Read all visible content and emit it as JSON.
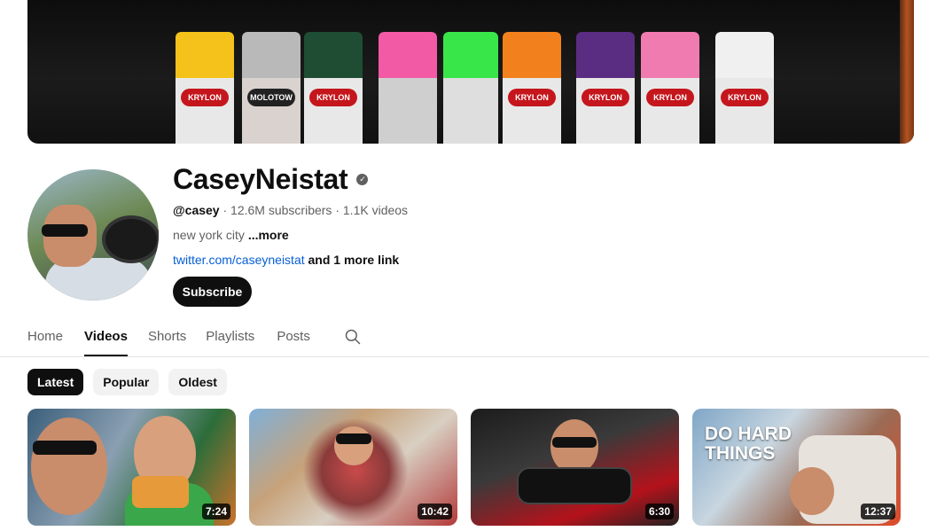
{
  "banner": {
    "cans": [
      {
        "cap": "#f4c21a",
        "label": "KRYLON"
      },
      {
        "cap": "#b9b9b9",
        "label": "MOLOTOW"
      },
      {
        "cap": "#1f4d33",
        "label": "KRYLON"
      },
      {
        "cap": "#f25aa6",
        "label": ""
      },
      {
        "cap": "#39e64a",
        "label": ""
      },
      {
        "cap": "#f2811d",
        "label": "KRYLON"
      },
      {
        "cap": "#5b2d82",
        "label": "KRYLON"
      },
      {
        "cap": "#f07bb0",
        "label": "KRYLON"
      },
      {
        "cap": "#f0f0f0",
        "label": "KRYLON"
      }
    ]
  },
  "channel": {
    "name": "CaseyNeistat",
    "verified_icon": "verified-check-icon",
    "handle": "@casey",
    "subscribers": "12.6M subscribers",
    "videos_count": "1.1K videos",
    "separator": "·",
    "description": "new york city",
    "more": "...more",
    "link": "twitter.com/caseyneistat",
    "more_links": "and 1 more link",
    "subscribe_label": "Subscribe"
  },
  "tabs": {
    "home": "Home",
    "videos": "Videos",
    "shorts": "Shorts",
    "playlists": "Playlists",
    "posts": "Posts",
    "search_icon": "search-icon"
  },
  "chips": {
    "latest": "Latest",
    "popular": "Popular",
    "oldest": "Oldest"
  },
  "videos": [
    {
      "duration": "7:24"
    },
    {
      "duration": "10:42"
    },
    {
      "duration": "6:30"
    },
    {
      "duration": "12:37",
      "overlay_text": "DO HARD THINGS"
    }
  ],
  "colors": {
    "subscribe_bg": "#0f0f0f",
    "link": "#065fd4",
    "chip_active": "#0f0f0f",
    "chip_inactive": "#f2f2f2"
  }
}
